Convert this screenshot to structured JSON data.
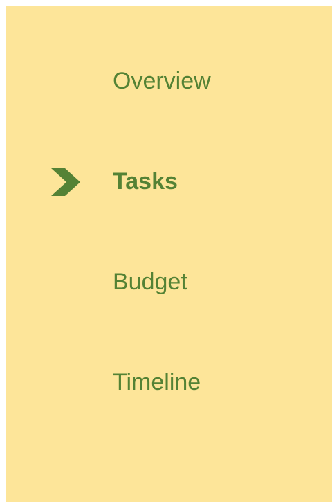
{
  "nav": {
    "items": [
      {
        "label": "Overview",
        "active": false
      },
      {
        "label": "Tasks",
        "active": true
      },
      {
        "label": "Budget",
        "active": false
      },
      {
        "label": "Timeline",
        "active": false
      }
    ],
    "active_indicator_icon": "chevron-right-icon"
  },
  "colors": {
    "panel_background": "#fde599",
    "text": "#548235",
    "indicator": "#548235"
  }
}
